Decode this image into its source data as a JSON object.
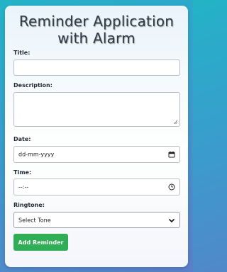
{
  "app": {
    "title_line1": "Reminder Application",
    "title_line2": "with Alarm"
  },
  "form": {
    "title_label": "Title:",
    "title_value": "",
    "description_label": "Description:",
    "description_value": "",
    "date_label": "Date:",
    "date_placeholder": "dd-mm-yyyy",
    "time_label": "Time:",
    "time_placeholder": "--:--",
    "ringtone_label": "Ringtone:",
    "ringtone_selected": "Select Tone",
    "submit_label": "Add Reminder"
  },
  "colors": {
    "background_start": "#23b3c7",
    "background_end": "#5b7fc9",
    "button": "#2fae55",
    "title_text": "#2f3a46"
  },
  "icons": {
    "date": "calendar-icon",
    "time": "clock-icon",
    "ringtone": "chevron-down-icon"
  }
}
